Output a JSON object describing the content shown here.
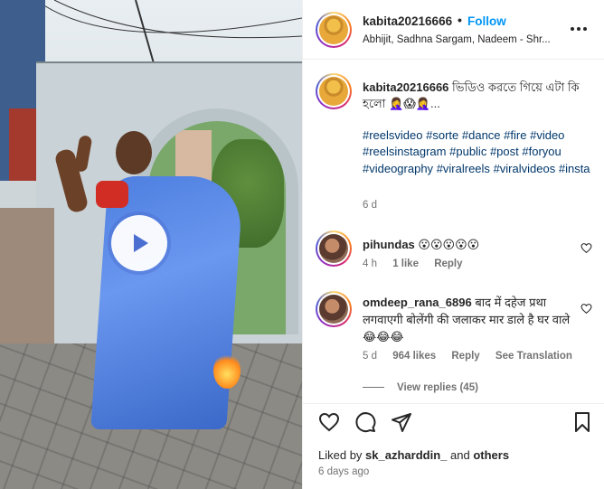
{
  "post": {
    "username": "kabita20216666",
    "follow_label": "Follow",
    "separator": "•",
    "audio": "Abhijit, Sadhna Sargam, Nadeem - Shr...",
    "caption_text": "ভিডিও করতে গিয়ে এটা কি হলো 🤦‍♀️😱🤦‍♀️...",
    "hashtags": [
      "#reelsvideo",
      "#sorte",
      "#dance",
      "#fire",
      "#video",
      "#reelsinstagram",
      "#public",
      "#post",
      "#foryou",
      "#videography",
      "#viralreels",
      "#viralvideos",
      "#insta"
    ],
    "caption_time": "6 d"
  },
  "comments": [
    {
      "username": "pihundas",
      "text": "😮😮😮😮😮",
      "time": "4 h",
      "likes": "1 like",
      "reply_label": "Reply"
    },
    {
      "username": "omdeep_rana_6896",
      "text": "बाद में दहेज प्रथा लगवाएगी बोलेंगी की जलाकर मार डाले है घर वाले 😂😂😂",
      "time": "5 d",
      "likes": "964 likes",
      "reply_label": "Reply",
      "translate_label": "See Translation",
      "view_replies": "View replies (45)"
    }
  ],
  "footer": {
    "liked_prefix": "Liked by",
    "liked_user": "sk_azharddin_",
    "liked_and": "and",
    "liked_others": "others",
    "time_ago": "6 days ago"
  },
  "icons": {
    "play": "play-icon",
    "more": "more-options-icon",
    "heart": "heart-icon",
    "comment": "comment-icon",
    "share": "share-icon",
    "save": "bookmark-icon"
  },
  "colors": {
    "accent": "#0095f6",
    "hashtag": "#00376b",
    "muted": "#737373"
  }
}
